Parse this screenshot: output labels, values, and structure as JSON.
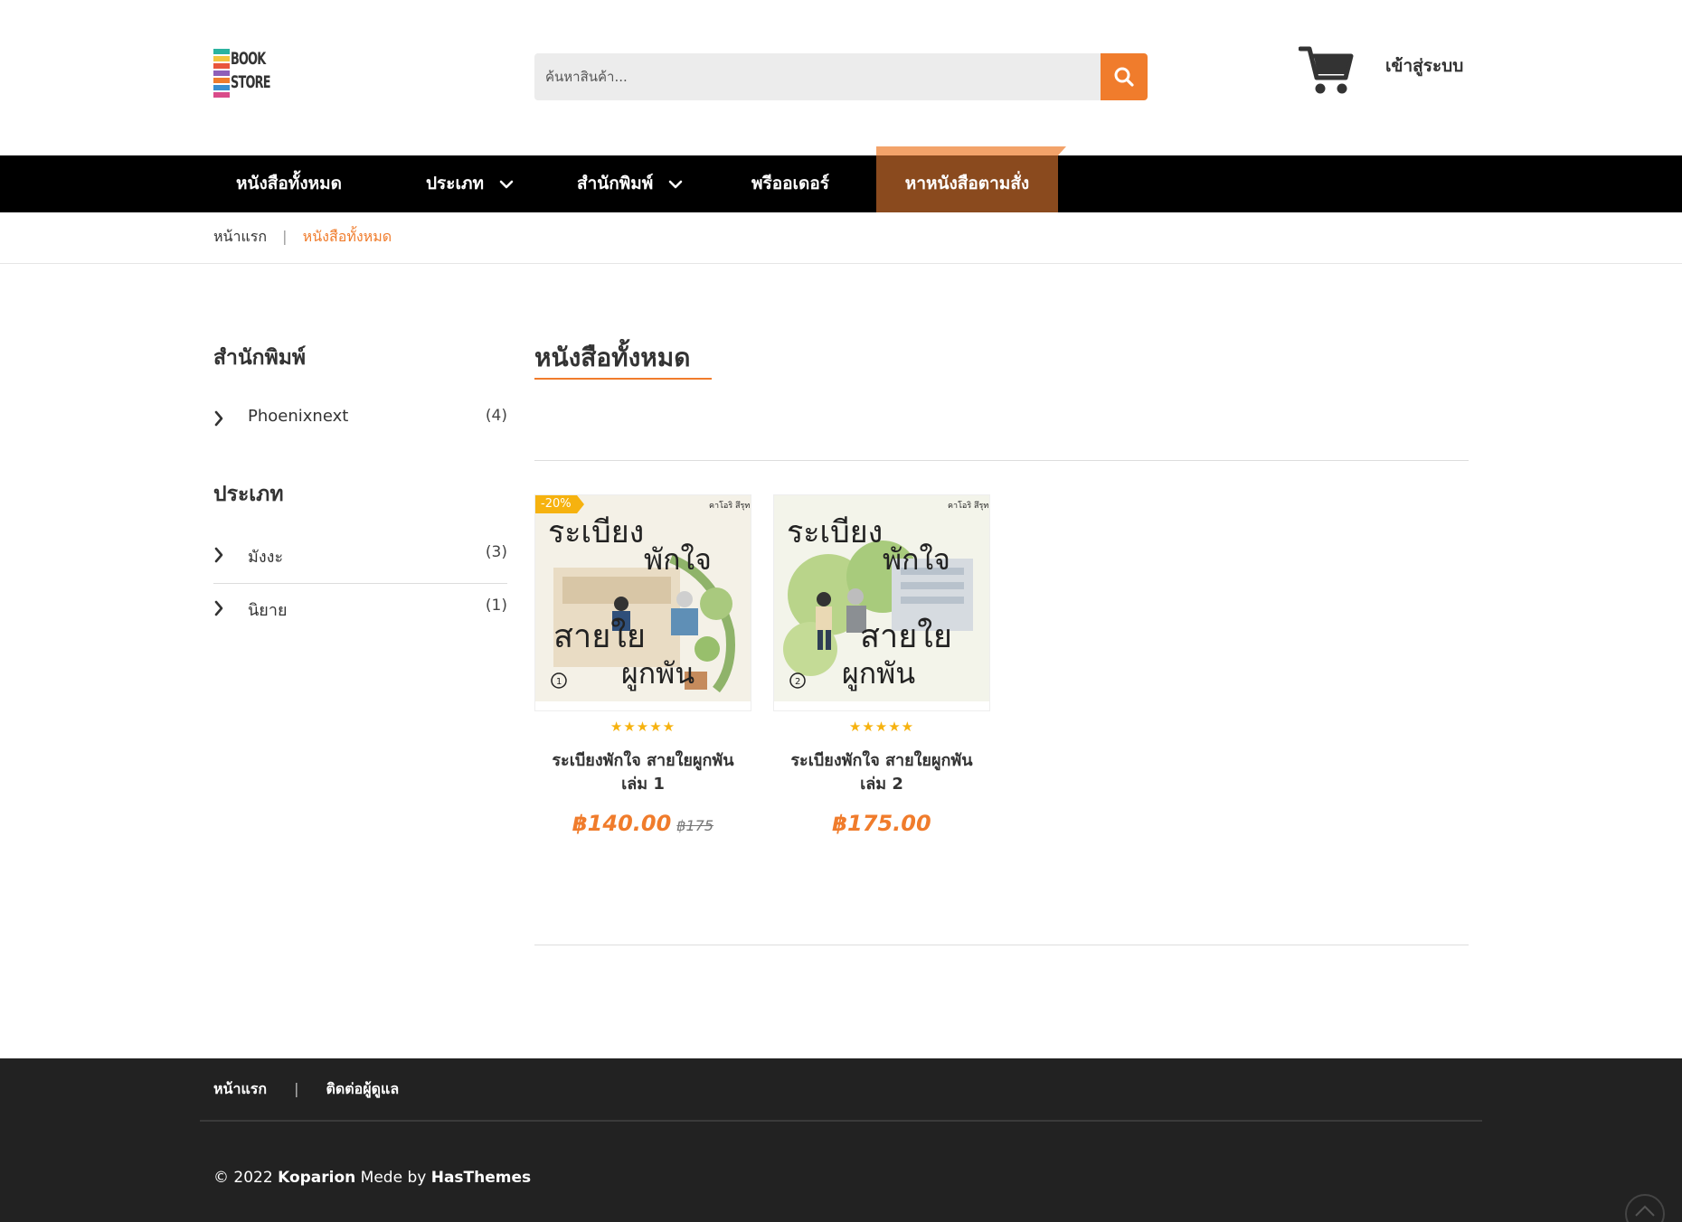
{
  "header": {
    "logo_text_line1": "BOOK",
    "logo_text_line2": "STORE",
    "search_placeholder": "ค้นหาสินค้า...",
    "login_label": "เข้าสู่ระบบ"
  },
  "nav": {
    "items": [
      {
        "label": "หนังสือทั้งหมด"
      },
      {
        "label": "ประเภท"
      },
      {
        "label": "สำนักพิมพ์"
      },
      {
        "label": "พรีออเดอร์"
      },
      {
        "label": "หาหนังสือตามสั่ง"
      }
    ]
  },
  "breadcrumb": {
    "home": "หน้าแรก",
    "separator": "|",
    "current": "หนังสือทั้งหมด"
  },
  "sidebar": {
    "publisher_title": "สำนักพิมพ์",
    "publishers": [
      {
        "name": "Phoenixnext",
        "count": "(4)"
      }
    ],
    "category_title": "ประเภท",
    "categories": [
      {
        "name": "มังงะ",
        "count": "(3)"
      },
      {
        "name": "นิยาย",
        "count": "(1)"
      }
    ]
  },
  "main": {
    "title": "หนังสือทั้งหมด",
    "products": [
      {
        "badge": "-20%",
        "cover_title_top": "ระเบียง",
        "cover_title_mid": "พักใจ",
        "cover_title_bot1": "สายใย",
        "cover_title_bot2": "ผูกพัน",
        "cover_author": "คาโอริ สึรุทานิ",
        "cover_volume": "1",
        "rating": 5,
        "stars": "★★★★★",
        "title_line1": "ระเบียงพักใจ สายใยผูกพัน",
        "title_line2": "เล่ม 1",
        "price": "฿140.00",
        "old_price": "฿175"
      },
      {
        "badge": "",
        "cover_title_top": "ระเบียง",
        "cover_title_mid": "พักใจ",
        "cover_title_bot1": "สายใย",
        "cover_title_bot2": "ผูกพัน",
        "cover_author": "คาโอริ สึรุทานิ",
        "cover_volume": "2",
        "rating": 5,
        "stars": "★★★★★",
        "title_line1": "ระเบียงพักใจ สายใยผูกพัน",
        "title_line2": "เล่ม 2",
        "price": "฿175.00",
        "old_price": ""
      }
    ]
  },
  "footer": {
    "links": [
      {
        "label": "หน้าแรก"
      },
      {
        "label": "ติดต่อผู้ดูแล"
      }
    ],
    "separator": "|",
    "copy_prefix": "© 2022",
    "copy_brand": "Koparion",
    "copy_mid": "Mede by",
    "copy_author": "HasThemes"
  },
  "colors": {
    "accent": "#f07c2c",
    "nav_bg": "#000000",
    "nav_highlight": "#8a4a1e",
    "footer_bg": "#222222",
    "star": "#f6b20f"
  },
  "icons": [
    "search-icon",
    "cart-icon",
    "chevron-down-icon",
    "chevron-right-icon",
    "scroll-top-icon"
  ]
}
